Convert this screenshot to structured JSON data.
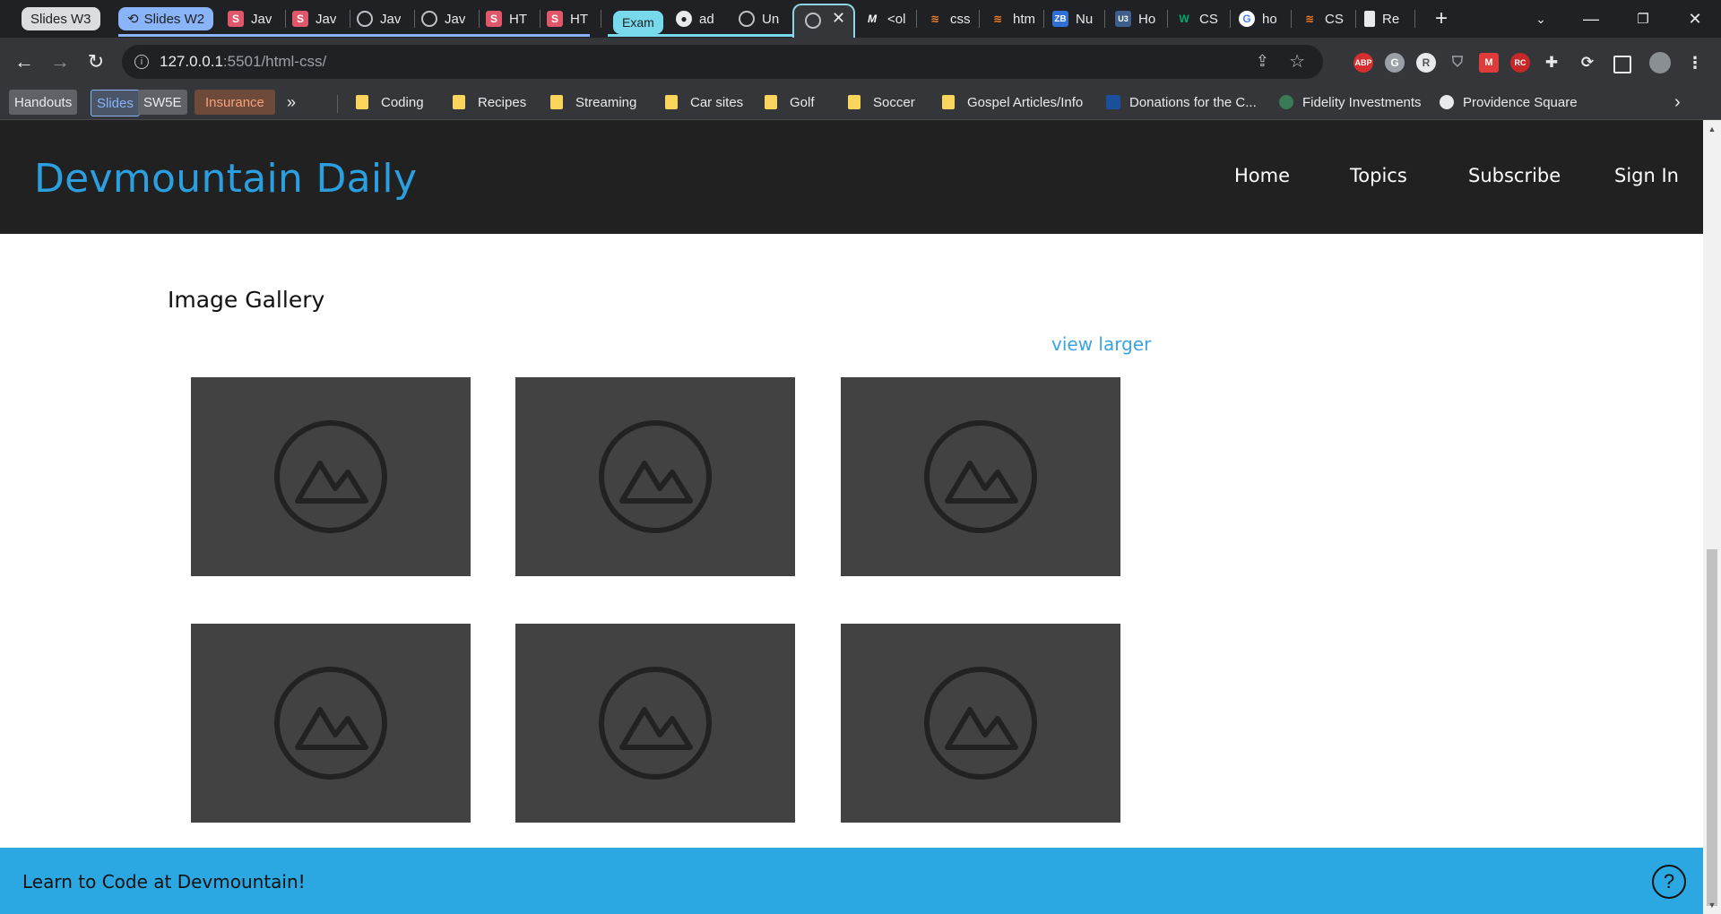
{
  "browser": {
    "groups": {
      "w3": "Slides W3",
      "w2": "Slides W2",
      "exam": "Exam"
    },
    "tabs": [
      {
        "label": "Jav",
        "icon": "s-favicon"
      },
      {
        "label": "Jav",
        "icon": "s-favicon"
      },
      {
        "label": "Jav",
        "icon": "globe-icon"
      },
      {
        "label": "Jav",
        "icon": "globe-icon"
      },
      {
        "label": "HT",
        "icon": "s-favicon"
      },
      {
        "label": "HT",
        "icon": "s-favicon"
      },
      {
        "label": "ad",
        "icon": "github-icon"
      },
      {
        "label": "Un",
        "icon": "globe-icon"
      },
      {
        "label": "<ol",
        "icon": "m-icon"
      },
      {
        "label": "css",
        "icon": "stackoverflow-icon"
      },
      {
        "label": "htm",
        "icon": "stackoverflow-icon"
      },
      {
        "label": "Nu",
        "icon": "zb-icon"
      },
      {
        "label": "Ho",
        "icon": "w3-icon"
      },
      {
        "label": "CS",
        "icon": "w-icon"
      },
      {
        "label": "ho",
        "icon": "google-icon"
      },
      {
        "label": "CS",
        "icon": "stackoverflow-icon"
      },
      {
        "label": "Re",
        "icon": "clipboard-icon"
      }
    ],
    "url_host": "127.0.0.1",
    "url_path": ":5501/html-css/",
    "bookmark_chips": {
      "handouts": "Handouts",
      "slides": "Slides",
      "sw5e": "SW5E",
      "insurance": "Insurance",
      "more": "»"
    },
    "bookmarks": [
      {
        "label": "Coding",
        "icon": "folder-icon"
      },
      {
        "label": "Recipes",
        "icon": "folder-icon"
      },
      {
        "label": "Streaming",
        "icon": "folder-icon"
      },
      {
        "label": "Car sites",
        "icon": "folder-icon"
      },
      {
        "label": "Golf",
        "icon": "folder-icon"
      },
      {
        "label": "Soccer",
        "icon": "folder-icon"
      },
      {
        "label": "Gospel Articles/Info",
        "icon": "folder-icon"
      },
      {
        "label": "Donations for the C...",
        "icon": "church-icon"
      },
      {
        "label": "Fidelity Investments",
        "icon": "fidelity-icon"
      },
      {
        "label": "Providence Square",
        "icon": "house-icon"
      }
    ],
    "extensions": [
      "ABP",
      "G",
      "R",
      "shield-icon",
      "M",
      "RC",
      "puzzle-icon",
      "refresh-icon",
      "sidepanel-icon",
      "avatar",
      "menu-icon"
    ]
  },
  "site": {
    "brand": "Devmountain Daily",
    "nav": {
      "home": "Home",
      "topics": "Topics",
      "subscribe": "Subscribe",
      "signin": "Sign In"
    },
    "gallery_title": "Image Gallery",
    "view_larger": "view larger",
    "thumbnail_count": 6,
    "footer_text": "Learn to Code at Devmountain!",
    "help_label": "?"
  },
  "colors": {
    "header_bg": "#212121",
    "brand": "#2b9fe0",
    "thumbnail_bg": "#424242",
    "footer_bg": "#2ba7e1"
  }
}
